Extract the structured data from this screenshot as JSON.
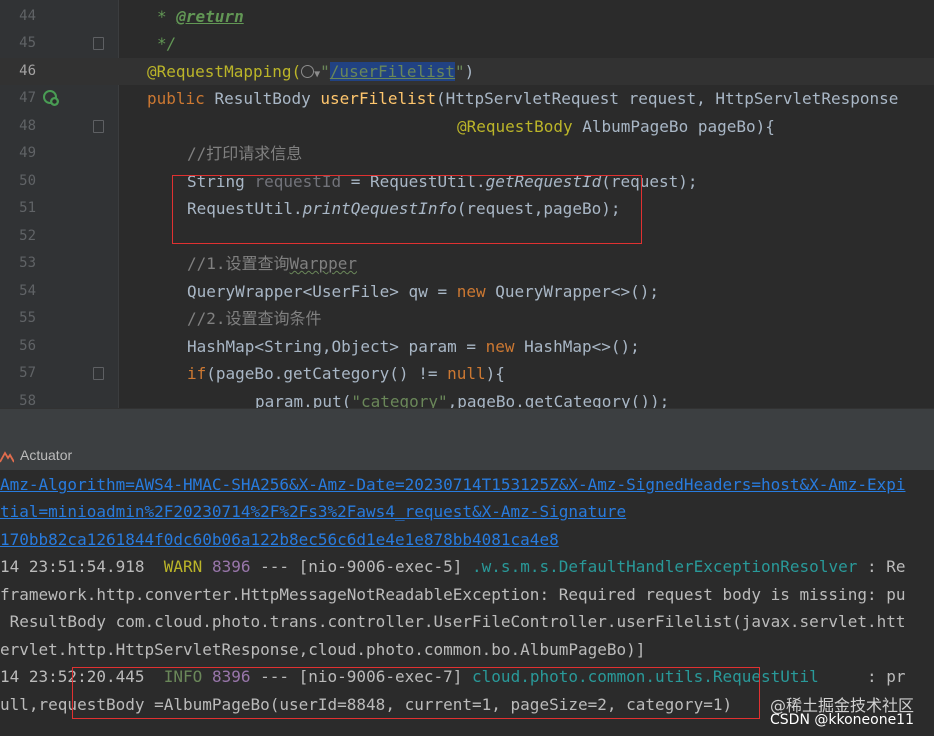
{
  "editor": {
    "line_numbers": [
      "44",
      "45",
      "46",
      "47",
      "48",
      "49",
      "50",
      "51",
      "52",
      "53",
      "54",
      "55",
      "56",
      "57",
      "58"
    ],
    "doc_star": "* ",
    "doc_return": "@return",
    "doc_end": "*/",
    "annotation": "@RequestMapping(",
    "url": "/userFilelist",
    "ann_close": ")",
    "kw_public": "public ",
    "type_resultbody": "ResultBody ",
    "method_name": "userFilelist",
    "params1": "(HttpServletRequest request, HttpServletResponse",
    "ann_requestbody": "@RequestBody ",
    "params2": "AlbumPageBo pageBo){",
    "comment_print": "//打印请求信息",
    "l50_a": "String ",
    "l50_var": "requestId",
    "l50_b": " = RequestUtil.",
    "l50_fn": "getRequestId",
    "l50_c": "(request);",
    "l51_a": "RequestUtil.",
    "l51_fn": "printQequestInfo",
    "l51_b": "(request,pageBo);",
    "comment_1": "//1.设置查询",
    "comment_1b": "Warpper",
    "l54_a": "QueryWrapper<UserFile> qw = ",
    "kw_new": "new",
    "l54_b": " QueryWrapper<>();",
    "comment_2": "//2.设置查询条件",
    "l56_a": "HashMap<String,Object> param = ",
    "l56_b": " HashMap<>();",
    "kw_if": "if",
    "l57_a": "(pageBo.getCategory() != ",
    "kw_null": "null",
    "l57_b": "){",
    "l58_a": "param.put(",
    "l58_str": "\"category\"",
    "l58_b": ",pageBo.getCategory());"
  },
  "panel": {
    "tab_label": "Actuator"
  },
  "console": {
    "line1": "Amz-Algorithm=AWS4-HMAC-SHA256&X-Amz-Date=20230714T153125Z&X-Amz-SignedHeaders=host&X-Amz-Expi",
    "line2": "tial=minioadmin%2F20230714%2F%2Fs3%2Faws4_request&X-Amz-Signature",
    "line3": "170bb82ca1261844f0dc60b06a122b8ec56c6d1e4e1e878bb4081ca4e8",
    "line4_time": "14 23:51:54.918  ",
    "line4_level": "WARN",
    "line4_pid": "8396",
    "line4_thread": " --- [nio-9006-exec-5] ",
    "line4_logger": ".w.s.m.s.DefaultHandlerExceptionResolver",
    "line4_msg": " : Re",
    "line5": "framework.http.converter.HttpMessageNotReadableException: Required request body is missing: pu",
    "line6": " ResultBody com.cloud.photo.trans.controller.UserFileController.userFilelist(javax.servlet.htt",
    "line7": "ervlet.http.HttpServletResponse,cloud.photo.common.bo.AlbumPageBo)]",
    "line8_time": "14 23:52:20.445  ",
    "line8_level": "INFO",
    "line8_pid": "8396",
    "line8_thread": " --- [nio-9006-exec-7] ",
    "line8_logger": "cloud.photo.common.utils.RequestUtil",
    "line8_msg": "     : pr",
    "line9": "ull,requestBody =AlbumPageBo(userId=8848, current=1, pageSize=2, category=1)"
  },
  "watermark": {
    "site": "@稀土掘金技术社区",
    "author": "CSDN @kkoneone11"
  },
  "colors": {
    "editor_bg": "#2b2b2b",
    "keyword": "#cc7832",
    "annotation": "#bbb529",
    "method": "#ffc66d",
    "string": "#6a8759",
    "link": "#287bde",
    "highlight_box": "#e03131"
  }
}
